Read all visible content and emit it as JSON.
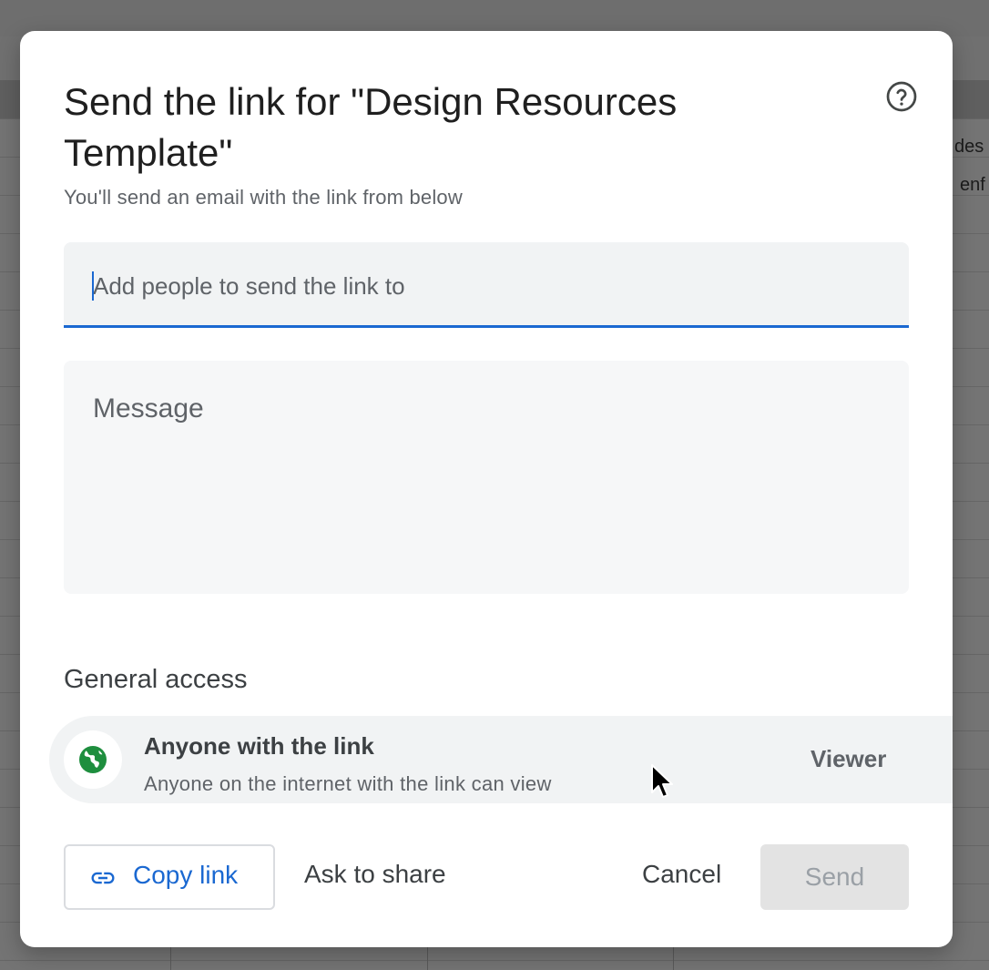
{
  "background": {
    "cell_texts": [
      "des",
      "enf"
    ]
  },
  "dialog": {
    "title": "Send the link for \"Design Resources Template\"",
    "subtitle": "You'll send an email with the link from below",
    "people_placeholder": "Add people to send the link to",
    "people_value": "",
    "message_placeholder": "Message",
    "message_value": "",
    "general_access": {
      "heading": "General access",
      "title": "Anyone with the link",
      "description": "Anyone on the internet with the link can view",
      "role": "Viewer",
      "icon": "globe-icon"
    },
    "buttons": {
      "copy_link": "Copy link",
      "ask_to_share": "Ask to share",
      "cancel": "Cancel",
      "send": "Send"
    },
    "help_icon": "help-circle-icon"
  },
  "colors": {
    "accent": "#1a68d1",
    "globe": "#1e8e3e",
    "send_disabled_bg": "#e3e3e3",
    "send_disabled_text": "#9aa0a6"
  }
}
